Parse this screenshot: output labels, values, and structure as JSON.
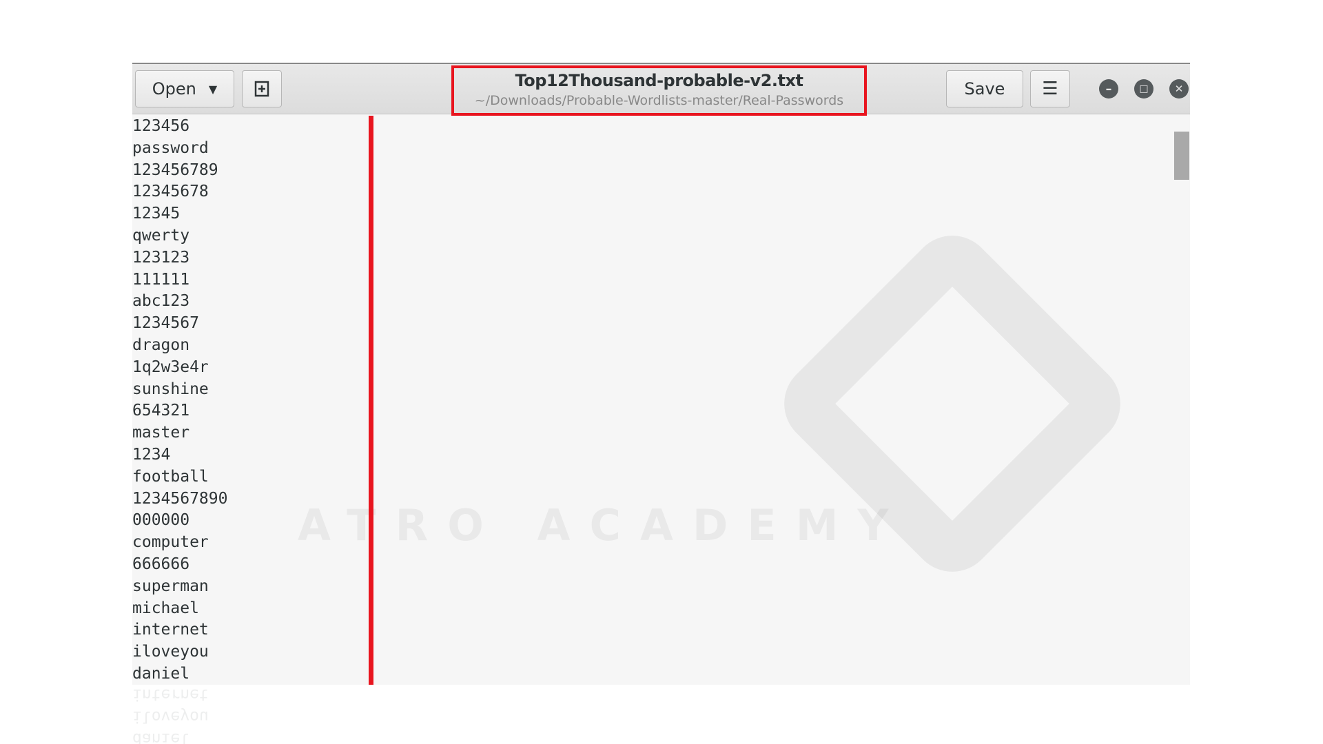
{
  "header": {
    "open_label": "Open",
    "save_label": "Save",
    "title": "Top12Thousand-probable-v2.txt",
    "path": "~/Downloads/Probable-Wordlists-master/Real-Passwords"
  },
  "watermark": "ATRO ACADEMY",
  "lines": [
    "123456",
    "password",
    "123456789",
    "12345678",
    "12345",
    "qwerty",
    "123123",
    "111111",
    "abc123",
    "1234567",
    "dragon",
    "1q2w3e4r",
    "sunshine",
    "654321",
    "master",
    "1234",
    "football",
    "1234567890",
    "000000",
    "computer",
    "666666",
    "superman",
    "michael",
    "internet",
    "iloveyou",
    "daniel"
  ],
  "colors": {
    "highlight": "#e8151f"
  }
}
